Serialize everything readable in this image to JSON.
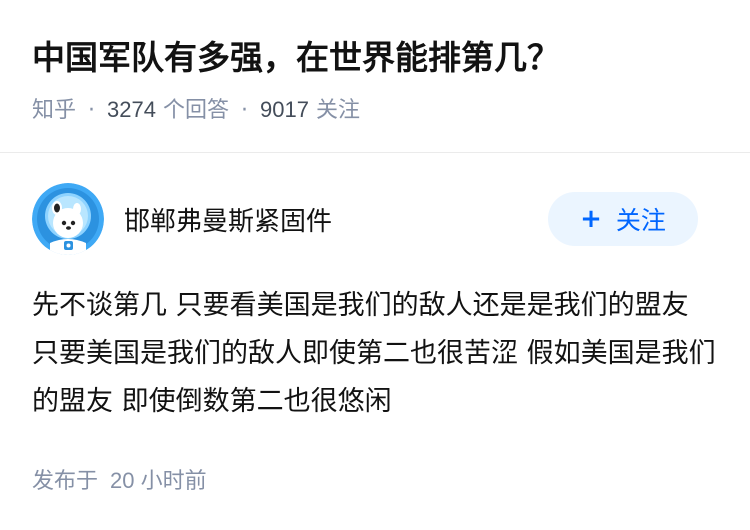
{
  "question": {
    "title": "中国军队有多强，在世界能排第几？",
    "source": "知乎",
    "answer_count": "3274",
    "answer_label": "个回答",
    "follower_count": "9017",
    "follower_label": "关注"
  },
  "author": {
    "avatar_icon": "astronaut-mascot-avatar-icon",
    "name": "邯郸弗曼斯紧固件",
    "follow_label": "关注",
    "follow_icon": "plus-icon"
  },
  "answer": {
    "text": "先不谈第几 只要看美国是我们的敌人还是是我们的盟友 只要美国是我们的敌人即使第二也很苦涩 假如美国是我们的盟友 即使倒数第二也很悠闲"
  },
  "footer": {
    "posted_label": "发布于",
    "posted_time": "20 小时前"
  },
  "colors": {
    "accent": "#0066ff",
    "follow_bg": "#ebf5ff",
    "meta_gray": "#8590a6",
    "avatar_bg": "#3fa9f5"
  }
}
